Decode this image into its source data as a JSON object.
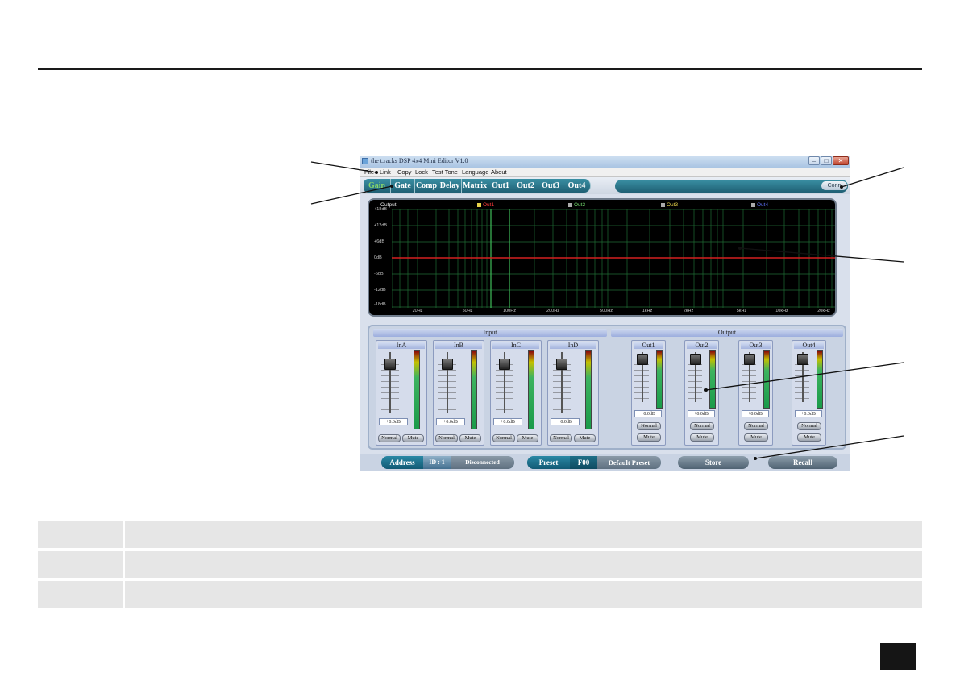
{
  "window": {
    "title": "the t.racks DSP 4x4 Mini Editor V1.0",
    "controls": [
      "–",
      "□",
      "✕"
    ]
  },
  "menu": [
    "File",
    "Link",
    "Copy",
    "Lock",
    "Test Tone",
    "Language",
    "About"
  ],
  "tabs": [
    "Gain",
    "Gate",
    "Comp",
    "Delay",
    "Matrix",
    "Out1",
    "Out2",
    "Out3",
    "Out4"
  ],
  "connect_button": "Conn",
  "graph": {
    "title": "Output",
    "legend": [
      {
        "label": "Out1",
        "color": "#ff3b3b"
      },
      {
        "label": "Out2",
        "color": "#6fd36a"
      },
      {
        "label": "Out3",
        "color": "#e6d24a"
      },
      {
        "label": "Out4",
        "color": "#5b6df0"
      }
    ],
    "y_labels": [
      "+18dB",
      "+12dB",
      "+6dB",
      "0dB",
      "-6dB",
      "-12dB",
      "-18dB"
    ],
    "x_labels": [
      "20Hz",
      "50Hz",
      "100Hz",
      "200Hz",
      "500Hz",
      "1kHz",
      "2kHz",
      "5kHz",
      "10kHz",
      "20kHz"
    ],
    "response_line_db": 0,
    "line_color": "#d42020"
  },
  "input": {
    "title": "Input",
    "channels": [
      {
        "name": "InA",
        "value": "+0.0dB",
        "mode": "Normal",
        "mute": "Mute"
      },
      {
        "name": "InB",
        "value": "+0.0dB",
        "mode": "Normal",
        "mute": "Mute"
      },
      {
        "name": "InC",
        "value": "+0.0dB",
        "mode": "Normal",
        "mute": "Mute"
      },
      {
        "name": "InD",
        "value": "+0.0dB",
        "mode": "Normal",
        "mute": "Mute"
      }
    ]
  },
  "output": {
    "title": "Output",
    "channels": [
      {
        "name": "Out1",
        "value": "+0.0dB",
        "mode": "Normal",
        "mute": "Mute"
      },
      {
        "name": "Out2",
        "value": "+0.0dB",
        "mode": "Normal",
        "mute": "Mute"
      },
      {
        "name": "Out3",
        "value": "+0.0dB",
        "mode": "Normal",
        "mute": "Mute"
      },
      {
        "name": "Out4",
        "value": "+0.0dB",
        "mode": "Normal",
        "mute": "Mute"
      }
    ]
  },
  "status": {
    "address_label": "Address",
    "id": "ID : 1",
    "connection": "Disconnected",
    "preset_label": "Preset",
    "preset_number": "F00",
    "preset_name": "Default Preset",
    "store": "Store",
    "recall": "Recall"
  }
}
